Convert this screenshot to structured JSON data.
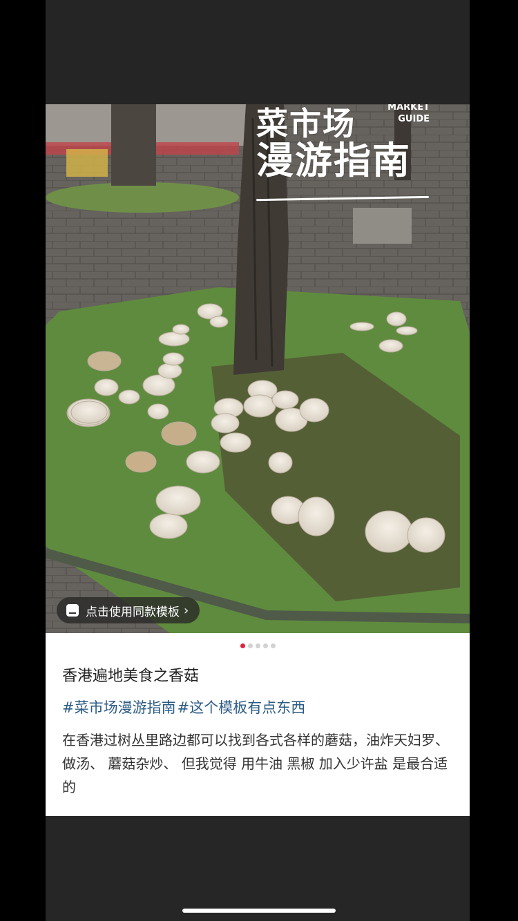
{
  "overlay": {
    "title_line1": "菜市场",
    "title_line2": "漫游指南",
    "brand_line1": "MARKET",
    "brand_line2": "GUIDE"
  },
  "template_button": {
    "label": "点击使用同款模板",
    "chevron": "›",
    "icon": "template-icon"
  },
  "pager": {
    "count": 5,
    "active_index": 0
  },
  "post": {
    "title": "香港遍地美食之香菇",
    "tags": [
      "#菜市场漫游指南",
      "#这个模板有点东西"
    ],
    "body": "在香港过树丛里路边都可以找到各式各样的蘑菇，油炸天妇罗、做汤、 蘑菇杂炒、 但我觉得 用牛油 黑椒 加入少许盐 是最合适的"
  },
  "colors": {
    "tag": "#2b5b84",
    "active_dot": "#e0243c",
    "background": "#262626"
  }
}
